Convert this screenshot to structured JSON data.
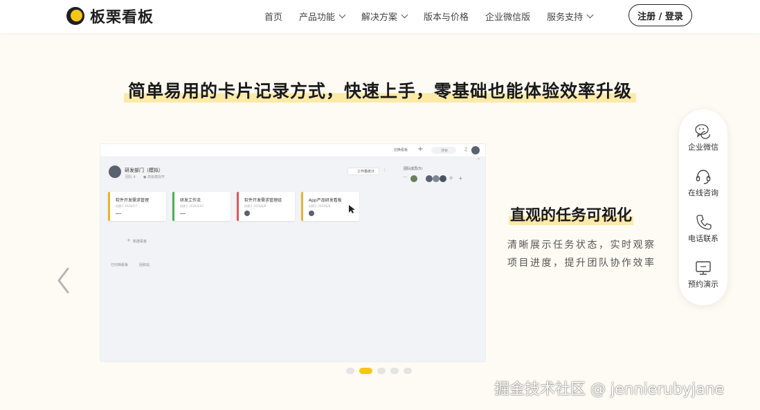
{
  "brand": {
    "name": "板栗看板",
    "accent": "#f5c518"
  },
  "nav": {
    "items": [
      {
        "label": "首页",
        "dropdown": false
      },
      {
        "label": "产品功能",
        "dropdown": true
      },
      {
        "label": "解决方案",
        "dropdown": true
      },
      {
        "label": "版本与价格",
        "dropdown": false
      },
      {
        "label": "企业微信版",
        "dropdown": false
      },
      {
        "label": "服务支持",
        "dropdown": true
      }
    ],
    "login_label": "注册 / 登录"
  },
  "hero": {
    "headline": "简单易用的卡片记录方式，快速上手，零基础也能体验效率升级"
  },
  "carousel": {
    "slide_count": 5,
    "active_index": 1,
    "screenshot": {
      "top_bar": {
        "switch_board": "切换看板",
        "search_placeholder": "搜索"
      },
      "department": {
        "name": "研发部门（模拟）",
        "tag1": "团队 4",
        "tag2": "● 高级模拟开"
      },
      "work_stats_button": "工作量统计",
      "members_label": "团队成员(5)",
      "boards": [
        {
          "title": "软件开发需求管理",
          "sub": "创建于 2024/7/7",
          "color": "#e8b62c"
        },
        {
          "title": "研发工作流",
          "sub": "创建于 2024/3/20",
          "color": "#4caf50"
        },
        {
          "title": "软件开发需求管理组",
          "sub": "创建于 2024/6/8",
          "color": "#e05555"
        },
        {
          "title": "App产品研发看板",
          "sub": "创建于 2024/6/8",
          "color": "#e8b62c"
        }
      ],
      "new_board": "新建看板",
      "archived_boards": "已归档看板",
      "recycle_bin": "回收站"
    },
    "feature_title": "直观的任务可视化",
    "feature_desc": "清晰展示任务状态，实时观察项目进度，提升团队协作效率"
  },
  "side_panel": [
    {
      "label": "企业微信",
      "icon": "wechat-icon"
    },
    {
      "label": "在线咨询",
      "icon": "headset-icon"
    },
    {
      "label": "电话联系",
      "icon": "phone-icon"
    },
    {
      "label": "预约演示",
      "icon": "monitor-icon"
    }
  ],
  "watermark": "掘金技术社区 @ jennierubyjane"
}
